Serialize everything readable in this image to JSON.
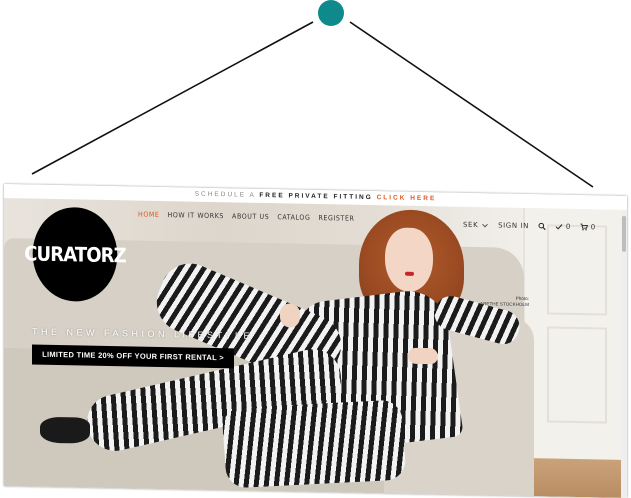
{
  "announcement": {
    "prefix": "SCHEDULE A",
    "strong": "FREE PRIVATE FITTING",
    "cta": "CLICK HERE"
  },
  "brand": {
    "logo": "CURATORZ"
  },
  "nav": {
    "items": [
      {
        "label": "HOME",
        "active": true
      },
      {
        "label": "HOW IT WORKS"
      },
      {
        "label": "ABOUT US"
      },
      {
        "label": "CATALOG"
      },
      {
        "label": "REGISTER"
      }
    ]
  },
  "account": {
    "currency": "SEK",
    "signin": "SIGN IN",
    "wishlist_count": "0",
    "cart_count": "0"
  },
  "hero": {
    "tagline": "THE NEW FASHION LIFESTYLE",
    "promo": "LIMITED TIME 20% OFF YOUR FIRST RENTAL >",
    "credit_line1": "Photo:",
    "credit_line2": "ARETHE STOCKHOLM"
  },
  "colors": {
    "accent": "#e0561e",
    "pin": "#0e8a8c",
    "logo_bg": "#000000"
  },
  "icons": [
    "chevron-down-icon",
    "search-icon",
    "check-icon",
    "cart-icon"
  ]
}
